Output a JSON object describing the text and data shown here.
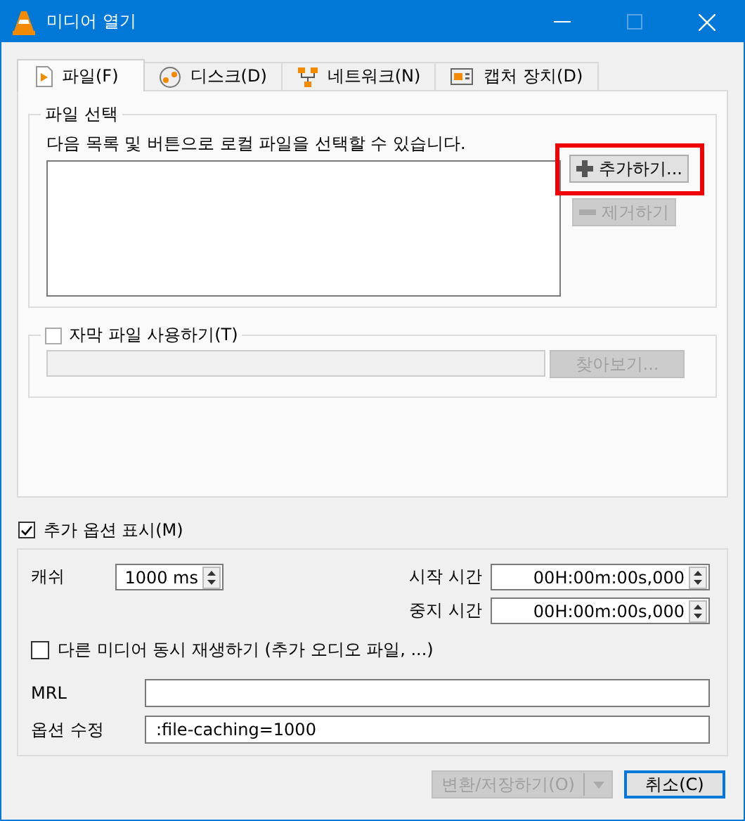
{
  "window": {
    "title": "미디어 열기"
  },
  "tabs": [
    {
      "label": "파일(F)",
      "kind": "file",
      "selected": true
    },
    {
      "label": "디스크(D)",
      "kind": "disc",
      "selected": false
    },
    {
      "label": "네트워크(N)",
      "kind": "network",
      "selected": false
    },
    {
      "label": "캡처 장치(D)",
      "kind": "capture",
      "selected": false
    }
  ],
  "file_selection": {
    "title": "파일 선택",
    "description": "다음 목록 및 버튼으로 로컬 파일을 선택할 수 있습니다.",
    "add_button": {
      "label": "추가하기...",
      "disabled": false,
      "highlighted": true
    },
    "remove_button": {
      "label": "제거하기",
      "disabled": true
    }
  },
  "subtitle": {
    "label": "자막 파일 사용하기(T)",
    "checked": false,
    "browse_button": {
      "label": "찾아보기...",
      "disabled": true
    }
  },
  "show_options": {
    "label": "추가 옵션 표시(M)",
    "checked": true
  },
  "options": {
    "caching": {
      "label": "캐쉬",
      "value": "1000 ms"
    },
    "start_time": {
      "label": "시작 시간",
      "value": "00H:00m:00s,000"
    },
    "stop_time": {
      "label": "중지 시간",
      "value": "00H:00m:00s,000"
    },
    "sync_play": {
      "label": "다른 미디어 동시 재생하기 (추가 오디오 파일, ...)",
      "checked": false
    },
    "mrl": {
      "label": "MRL"
    },
    "edit_options": {
      "label": "옵션 수정",
      "value": ":file-caching=1000"
    }
  },
  "buttons": [
    {
      "label": "변환/저장하기(O)",
      "kind": "split",
      "disabled": true
    },
    {
      "label": "취소(C)",
      "kind": "default",
      "disabled": false
    }
  ]
}
